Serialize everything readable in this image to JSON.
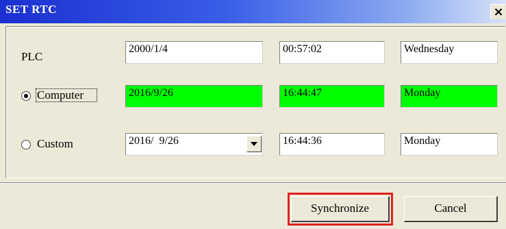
{
  "window": {
    "title": "SET RTC",
    "close_label": "×"
  },
  "rows": {
    "plc": {
      "label": "PLC",
      "date": "2000/1/4",
      "time": "00:57:02",
      "day": "Wednesday"
    },
    "computer": {
      "label": "Computer",
      "selected": true,
      "date": "2016/9/26",
      "time": "16:44:47",
      "day": "Monday"
    },
    "custom": {
      "label": "Custom",
      "selected": false,
      "date": "2016/  9/26",
      "time": "16:44:36",
      "day": "Monday"
    }
  },
  "buttons": {
    "synchronize": "Synchronize",
    "cancel": "Cancel"
  },
  "colors": {
    "sync_bg": "#00ff00",
    "highlight": "#e02020",
    "titlebar": "#1a2fd0"
  }
}
